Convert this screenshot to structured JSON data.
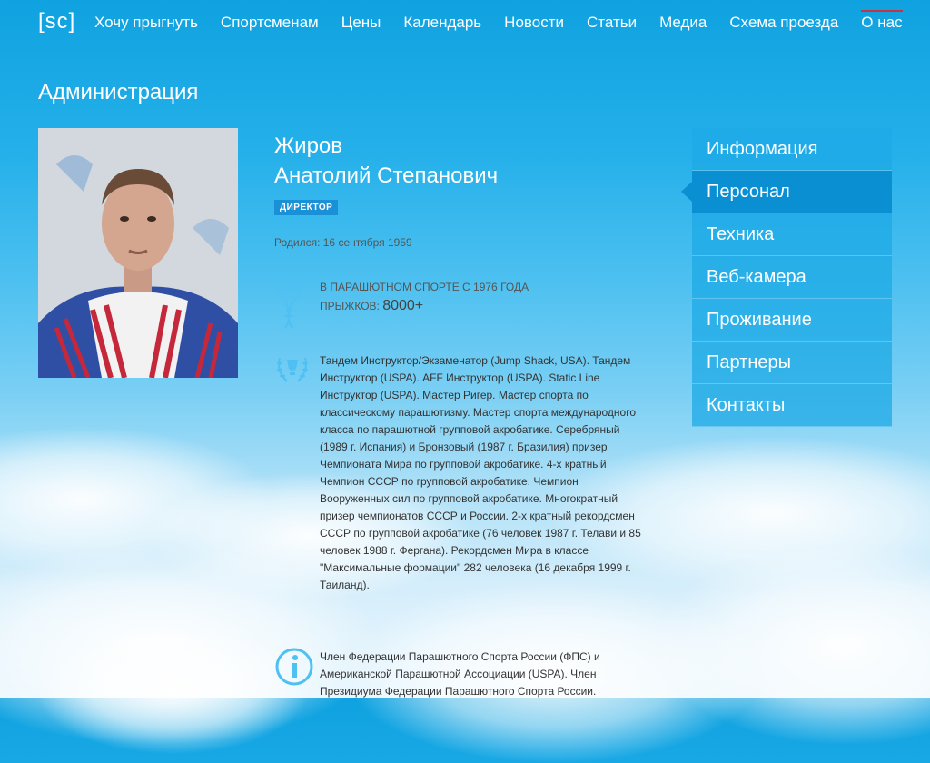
{
  "nav": {
    "logo": "[sc]",
    "items": [
      {
        "label": "Хочу прыгнуть"
      },
      {
        "label": "Спортсменам"
      },
      {
        "label": "Цены"
      },
      {
        "label": "Календарь"
      },
      {
        "label": "Новости"
      },
      {
        "label": "Статьи"
      },
      {
        "label": "Медиа"
      },
      {
        "label": "Схема проезда"
      },
      {
        "label": "О нас",
        "active": true
      }
    ]
  },
  "page": {
    "title": "Администрация"
  },
  "person": {
    "last_name": "Жиров",
    "first_names": "Анатолий Степанович",
    "role": "ДИРЕКТОР",
    "born": "Родился: 16 сентября 1959",
    "experience_title": "В ПАРАШЮТНОМ СПОРТЕ С 1976 ГОДА",
    "jumps_label": "ПРЫЖКОВ:",
    "jumps_value": "8000+",
    "bio": "Тандем Инструктор/Экзаменатор (Jump Shack, USA). Тандем Инструктор (USPA). AFF Инструктор (USPA). Static Line Инструктор (USPA). Мастер Ригер. Мастер спорта по классическому парашютизму. Мастер спорта международного класса по парашютной групповой акробатике. Серебряный (1989 г. Испания) и Бронзовый (1987 г. Бразилия) призер Чемпионата Мира по групповой акробатике. 4-х кратный Чемпион СССР по групповой акробатике. Чемпион Вооруженных сил по групповой акробатике. Многократный призер чемпионатов СССР и России. 2-х кратный рекордсмен СССР по групповой акробатике (76 человек 1987 г. Телави и 85 человек 1988 г. Фергана). Рекордсмен Мира в классе \"Максимальные формации\" 282 человека (16 декабря 1999 г. Таиланд).",
    "membership": "Член Федерации Парашютного Спорта России (ФПС) и Американской Парашютной Ассоциации (USPA). Член Президиума Федерации Парашютного Спорта России."
  },
  "sidebar": {
    "items": [
      {
        "label": "Информация"
      },
      {
        "label": "Персонал",
        "active": true
      },
      {
        "label": "Техника"
      },
      {
        "label": "Веб-камера"
      },
      {
        "label": "Проживание"
      },
      {
        "label": "Партнеры"
      },
      {
        "label": "Контакты"
      }
    ]
  },
  "colors": {
    "accent": "#0a8fd2",
    "badge": "#1a90d6",
    "active_nav_marker": "#c8333f"
  }
}
